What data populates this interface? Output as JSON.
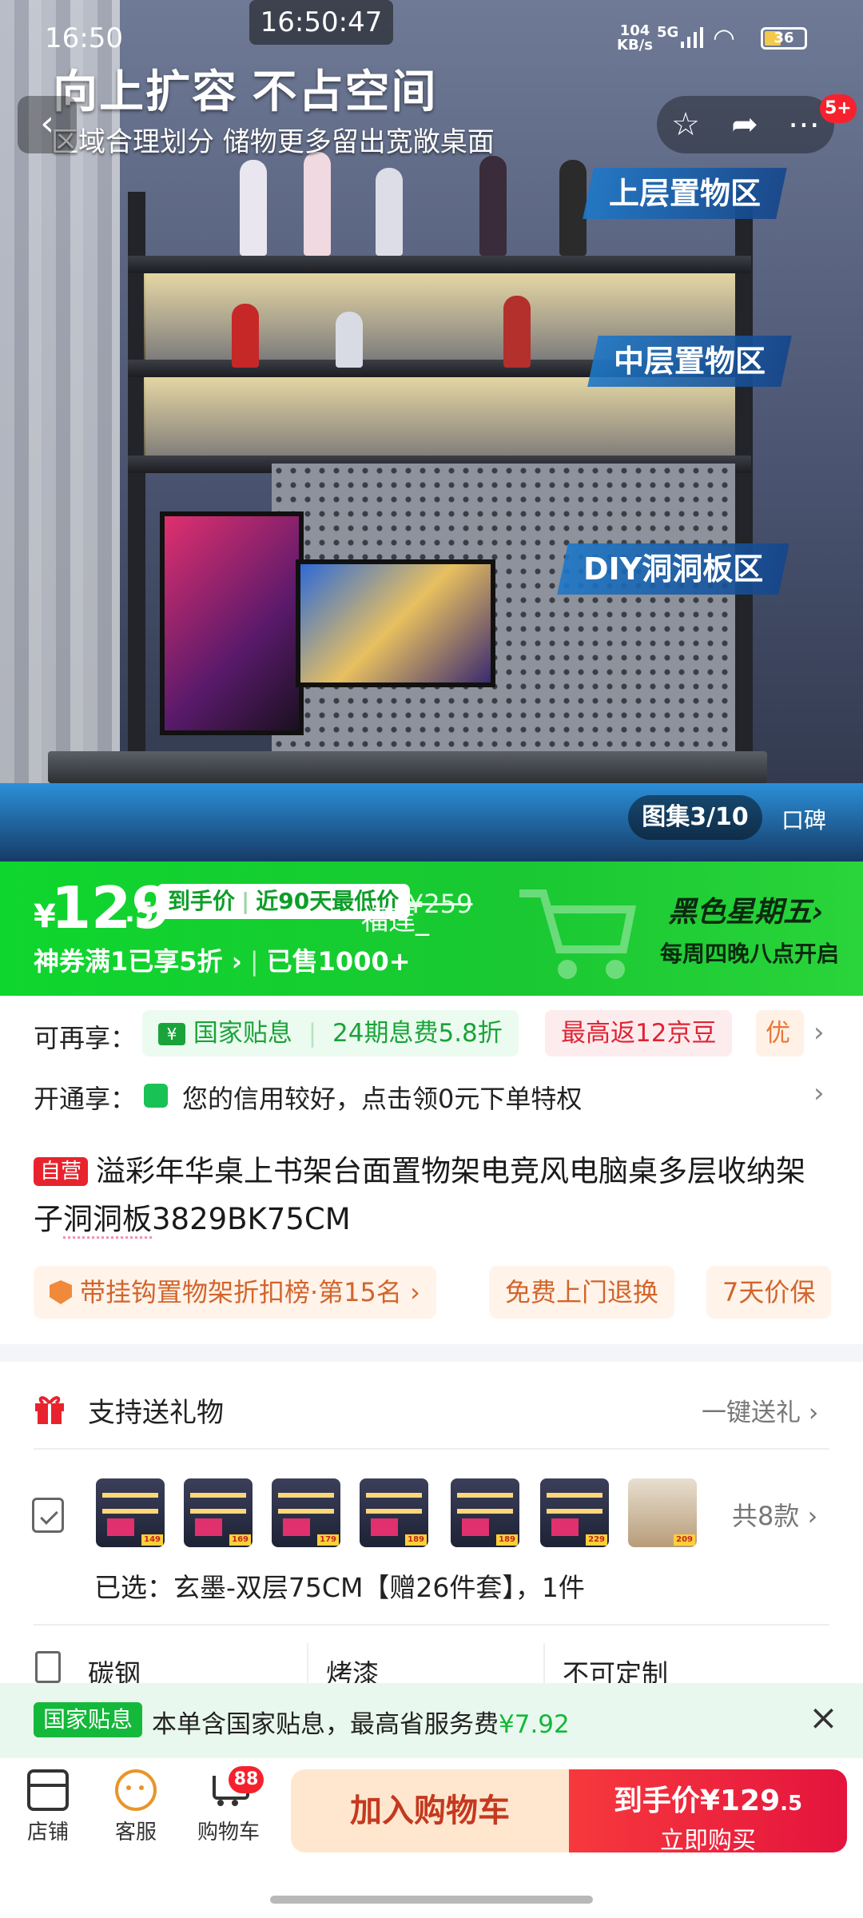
{
  "status_bar": {
    "time": "16:50",
    "clock_overlay": "16:50:47",
    "net_speed_value": "104",
    "net_speed_unit": "KB/s",
    "signal_type": "5G",
    "battery": "36"
  },
  "hero": {
    "headline": "向上扩容 不占空间",
    "subline": "区域合理划分 储物更多留出宽敞桌面",
    "zone_upper": "上层置物区",
    "zone_middle": "中层置物区",
    "zone_diy": "DIY洞洞板区",
    "gallery_counter": "图集3/10",
    "stamp_text": "口碑",
    "more_badge": "5+"
  },
  "price_banner": {
    "currency": "¥",
    "price_int": "129",
    "price_dec": ".5",
    "label_final": "到手价",
    "label_lowest": "近90天最低价",
    "original_price": "¥259",
    "coupon": "神券满1已享5折",
    "sold": "已售1000+",
    "promo_title": "黑色星期五",
    "promo_sub": "每周四晚八点开启",
    "overlay_text": "福莲_"
  },
  "benefits": {
    "label": "可再享：",
    "chip_subsidy": "国家贴息",
    "chip_installment": "24期息费5.8折",
    "chip_beans": "最高返12京豆",
    "chip_more": "优"
  },
  "membership": {
    "label": "开通享：",
    "text": "您的信用较好，点击领0元下单特权"
  },
  "product": {
    "self_operated": "自营",
    "title_a": "溢彩年华桌上书架台面置物架电竞风电脑桌多层收纳架子",
    "title_underlined": "洞洞板",
    "title_b": "3829BK75CM"
  },
  "tags": {
    "rank": "带挂钩置物架折扣榜·第15名",
    "return": "免费上门退换",
    "price_protect": "7天价保"
  },
  "gift": {
    "label": "支持送礼物",
    "action": "一键送礼"
  },
  "sku": {
    "thumb_prices": [
      "149",
      "169",
      "179",
      "189",
      "189",
      "229",
      "209"
    ],
    "count": "共8款",
    "selected": "已选：玄墨-双层75CM【赠26件套】，1件"
  },
  "specs": [
    "碳钢",
    "烤漆",
    "不可定制"
  ],
  "subsidy_bar": {
    "tag": "国家贴息",
    "text": "本单含国家贴息，最高省服务费",
    "amount": "¥7.92"
  },
  "bottom_bar": {
    "store": "店铺",
    "service": "客服",
    "cart": "购物车",
    "cart_badge": "88",
    "add_to_cart": "加入购物车",
    "buy_price_label": "到手价",
    "buy_price": "¥129",
    "buy_price_dec": ".5",
    "buy_now": "立即购买"
  },
  "colors": {
    "brand_green": "#19c832",
    "buy_red": "#e4143d",
    "subsidy_green": "#14b83a"
  }
}
